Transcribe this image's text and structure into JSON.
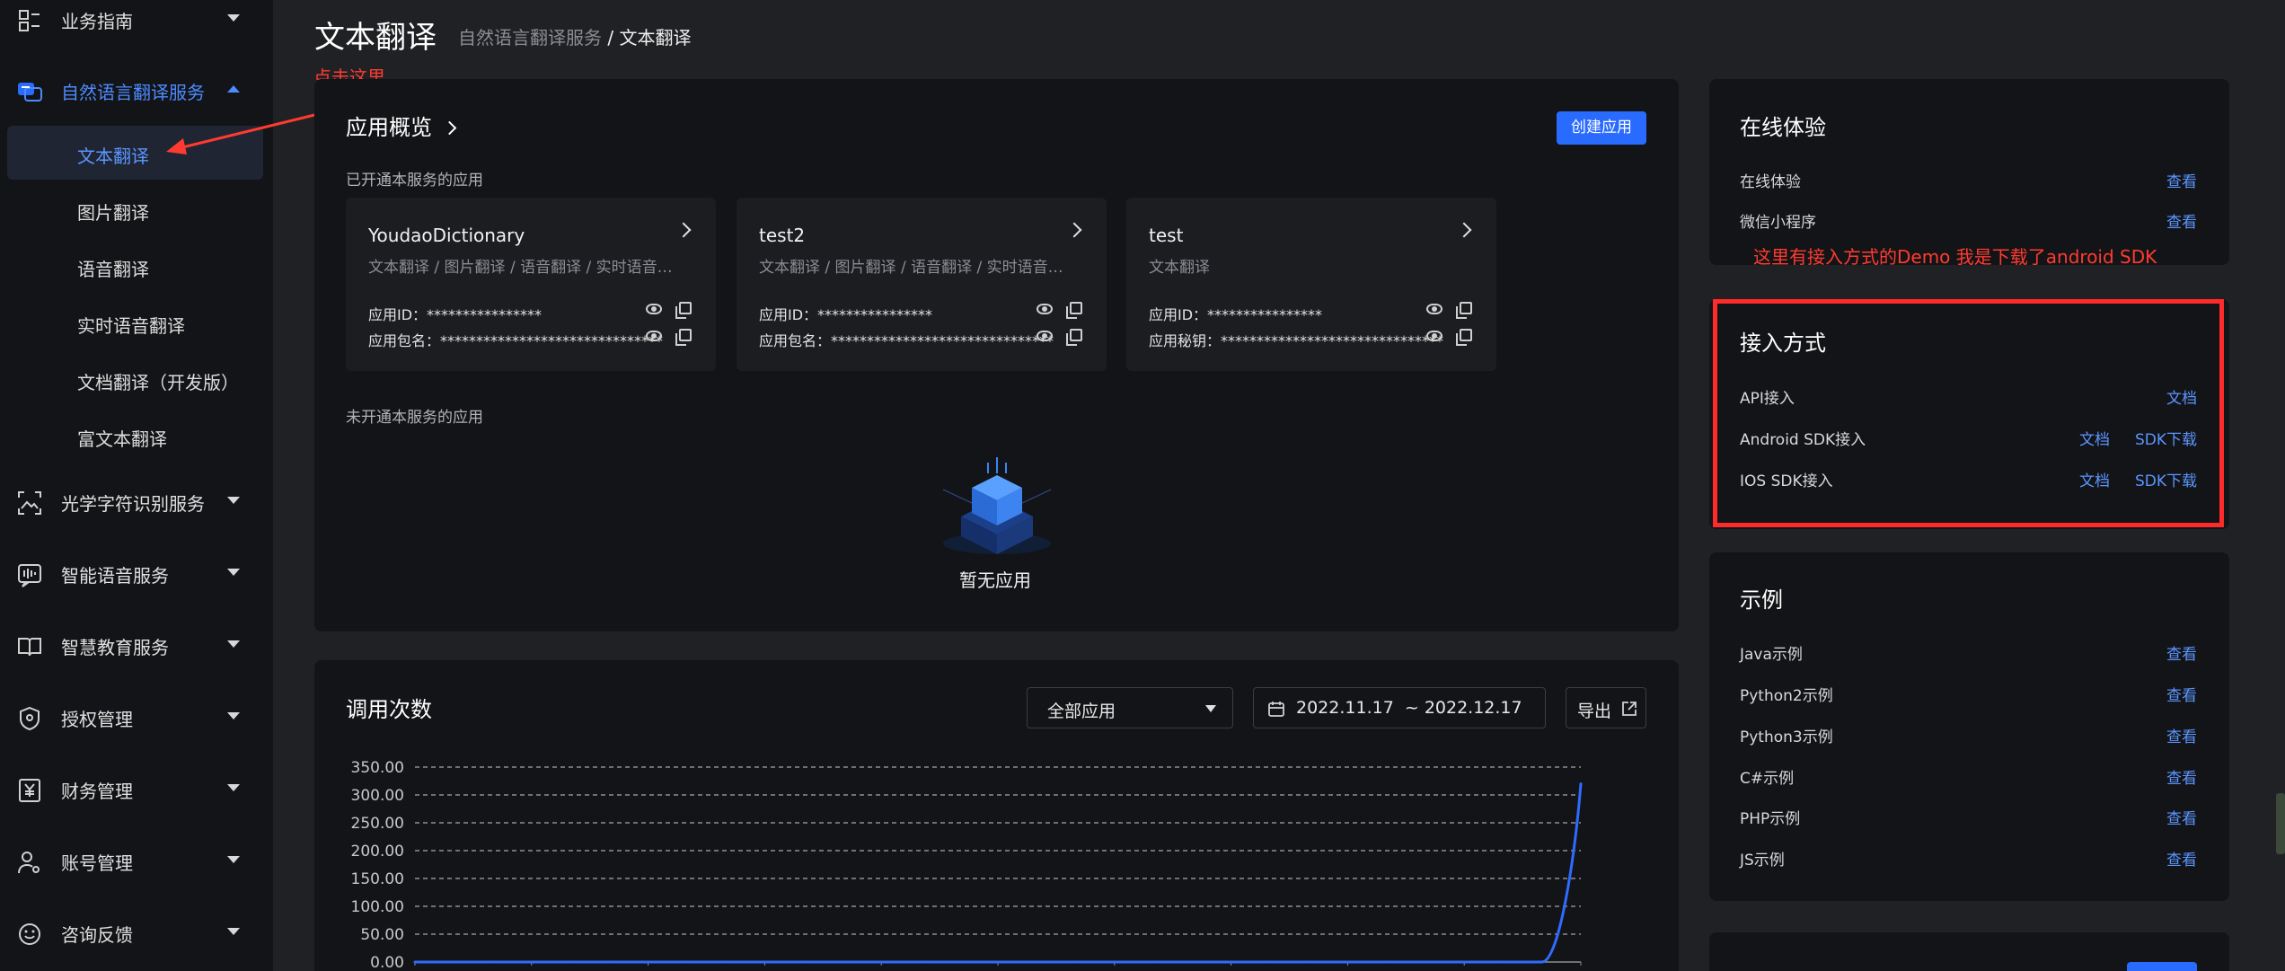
{
  "sidebar": {
    "items": [
      {
        "label": "业务指南",
        "icon": "guide-grid-icon"
      },
      {
        "label": "自然语言翻译服务",
        "icon": "translate-chat-icon",
        "expanded": true
      },
      {
        "label": "光学字符识别服务",
        "icon": "image-scan-icon"
      },
      {
        "label": "智能语音服务",
        "icon": "voice-wave-icon"
      },
      {
        "label": "智慧教育服务",
        "icon": "book-icon"
      },
      {
        "label": "授权管理",
        "icon": "shield-icon"
      },
      {
        "label": "财务管理",
        "icon": "yen-bill-icon"
      },
      {
        "label": "账号管理",
        "icon": "user-gear-icon"
      },
      {
        "label": "咨询反馈",
        "icon": "smile-chat-icon"
      }
    ],
    "subitems": [
      "文本翻译",
      "图片翻译",
      "语音翻译",
      "实时语音翻译",
      "文档翻译（开发版）",
      "富文本翻译"
    ]
  },
  "header": {
    "title": "文本翻译",
    "breadcrumb_parent": "自然语言翻译服务",
    "breadcrumb_sep": " / ",
    "breadcrumb_current": "文本翻译"
  },
  "annotations": {
    "click_here": "点击这里",
    "demo_note": "这里有接入方式的Demo 我是下载了android SDK"
  },
  "overview": {
    "title": "应用概览",
    "create_button": "创建应用",
    "enabled_label": "已开通本服务的应用",
    "disabled_label": "未开通本服务的应用",
    "empty_text": "暂无应用",
    "apps": [
      {
        "name": "YoudaoDictionary",
        "services": "文本翻译 / 图片翻译 / 语音翻译 / 实时语音翻译 / 文档翻译",
        "id_label": "应用ID：",
        "id_value": "****************",
        "second_label": "应用包名：",
        "second_value": "*******************************"
      },
      {
        "name": "test2",
        "services": "文本翻译 / 图片翻译 / 语音翻译 / 实时语音翻译 / 文档翻译",
        "id_label": "应用ID：",
        "id_value": "****************",
        "second_label": "应用包名：",
        "second_value": "*******************************"
      },
      {
        "name": "test",
        "services": "文本翻译",
        "id_label": "应用ID：",
        "id_value": "****************",
        "second_label": "应用秘钥：",
        "second_value": "*******************************"
      }
    ]
  },
  "usage": {
    "title": "调用次数",
    "app_select": "全部应用",
    "date_range": "2022.11.17  ~ 2022.12.17",
    "export_label": "导出"
  },
  "chart_data": {
    "type": "line",
    "title": "",
    "ylim": [
      0,
      350
    ],
    "y_ticks": [
      "350.00",
      "300.00",
      "250.00",
      "200.00",
      "150.00",
      "100.00",
      "50.00",
      "0.00"
    ],
    "grid": true,
    "series": [
      {
        "values": [
          0,
          0,
          0,
          0,
          0,
          0,
          0,
          0,
          0,
          0,
          0,
          0,
          0,
          0,
          0,
          0,
          0,
          0,
          0,
          0,
          0,
          0,
          0,
          0,
          0,
          0,
          0,
          0,
          0,
          0,
          320
        ]
      }
    ],
    "line_color": "#2f6bff"
  },
  "online": {
    "title": "在线体验",
    "rows": [
      {
        "label": "在线体验",
        "link": "查看"
      },
      {
        "label": "微信小程序",
        "link": "查看"
      }
    ]
  },
  "access": {
    "title": "接入方式",
    "rows": [
      {
        "label": "API接入",
        "links": [
          "文档"
        ]
      },
      {
        "label": "Android SDK接入",
        "links": [
          "文档",
          "SDK下载"
        ]
      },
      {
        "label": "IOS SDK接入",
        "links": [
          "文档",
          "SDK下载"
        ]
      }
    ]
  },
  "examples": {
    "title": "示例",
    "rows": [
      {
        "label": "Java示例",
        "link": "查看"
      },
      {
        "label": "Python2示例",
        "link": "查看"
      },
      {
        "label": "Python3示例",
        "link": "查看"
      },
      {
        "label": "C#示例",
        "link": "查看"
      },
      {
        "label": "PHP示例",
        "link": "查看"
      },
      {
        "label": "JS示例",
        "link": "查看"
      }
    ]
  },
  "colors": {
    "accent": "#2a6bff",
    "link": "#5b95ff",
    "annotation": "#ff2a2a"
  }
}
